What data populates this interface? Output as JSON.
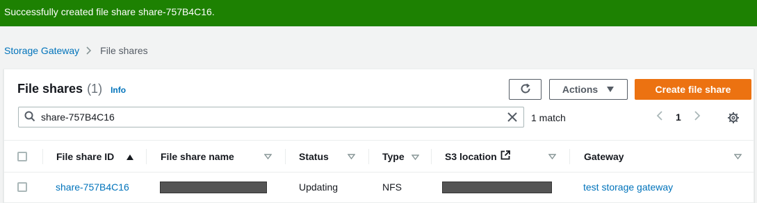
{
  "flash": {
    "message": "Successfully created file share share-757B4C16."
  },
  "breadcrumb": {
    "items": [
      "Storage Gateway",
      "File shares"
    ]
  },
  "header": {
    "title": "File shares",
    "count": "(1)",
    "info": "Info"
  },
  "toolbar": {
    "refresh_icon": "refresh-icon",
    "actions_label": "Actions",
    "create_label": "Create file share"
  },
  "search": {
    "value": "share-757B4C16",
    "match_text": "1 match"
  },
  "pagination": {
    "current_page": "1"
  },
  "table": {
    "columns": [
      "File share ID",
      "File share name",
      "Status",
      "Type",
      "S3 location",
      "Gateway"
    ],
    "rows": [
      {
        "id": "share-757B4C16",
        "name": "",
        "status": "Updating",
        "type": "NFS",
        "s3_location": "",
        "gateway": "test storage gateway"
      }
    ]
  },
  "colors": {
    "success": "#1d8102",
    "primary": "#ec7211",
    "link": "#0073bb"
  }
}
